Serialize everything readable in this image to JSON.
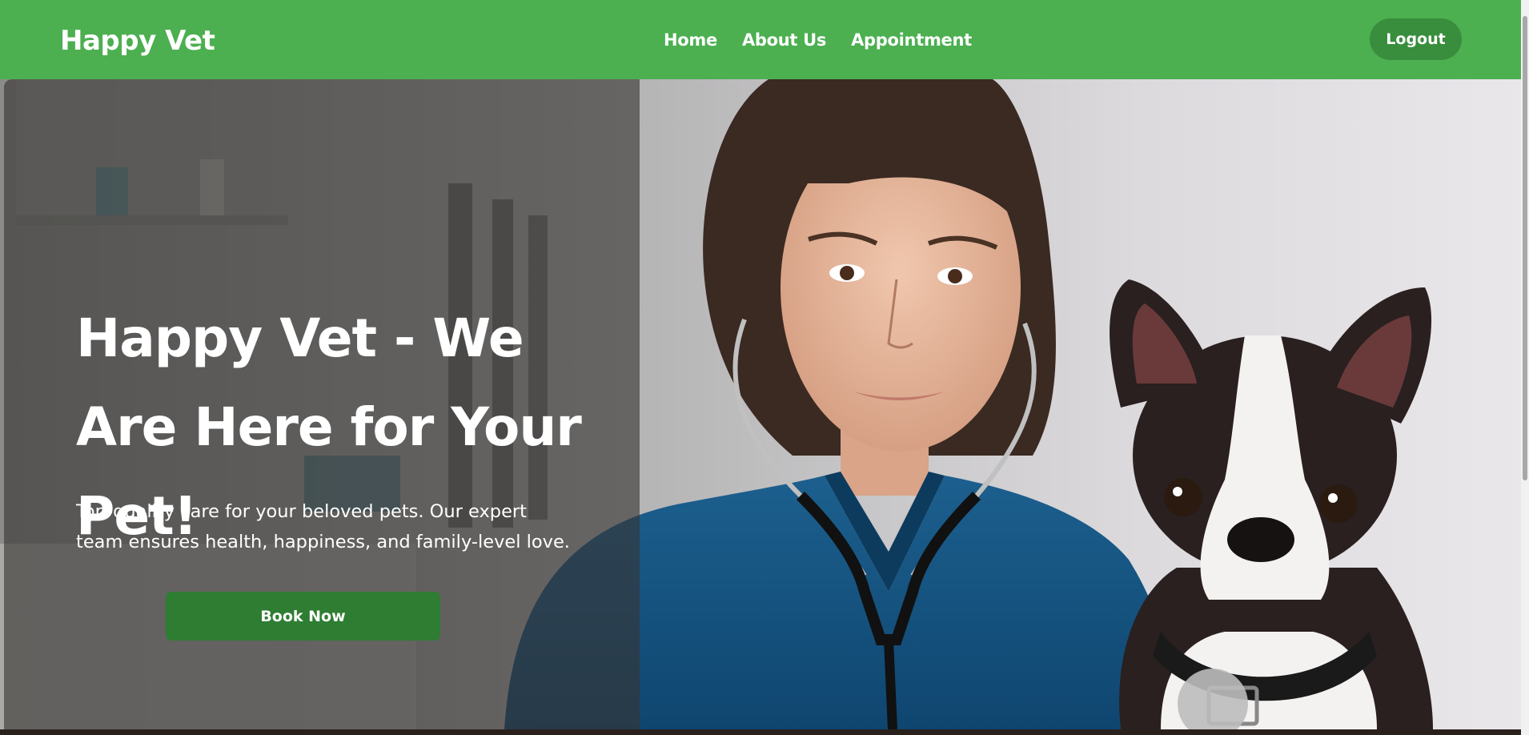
{
  "navbar": {
    "brand": "Happy Vet",
    "links": [
      {
        "label": "Home"
      },
      {
        "label": "About Us"
      },
      {
        "label": "Appointment"
      }
    ],
    "logout_label": "Logout"
  },
  "hero": {
    "title": "Happy Vet - We Are Here for Your Pet!",
    "description": "Top-quality care for your beloved pets. Our expert team ensures health, happiness, and family-level love.",
    "cta_label": "Book Now"
  },
  "colors": {
    "primary_green": "#4caf50",
    "dark_green": "#2e7d32",
    "logout_green": "#388e3c",
    "overlay": "rgba(55,52,50,0.62)"
  }
}
